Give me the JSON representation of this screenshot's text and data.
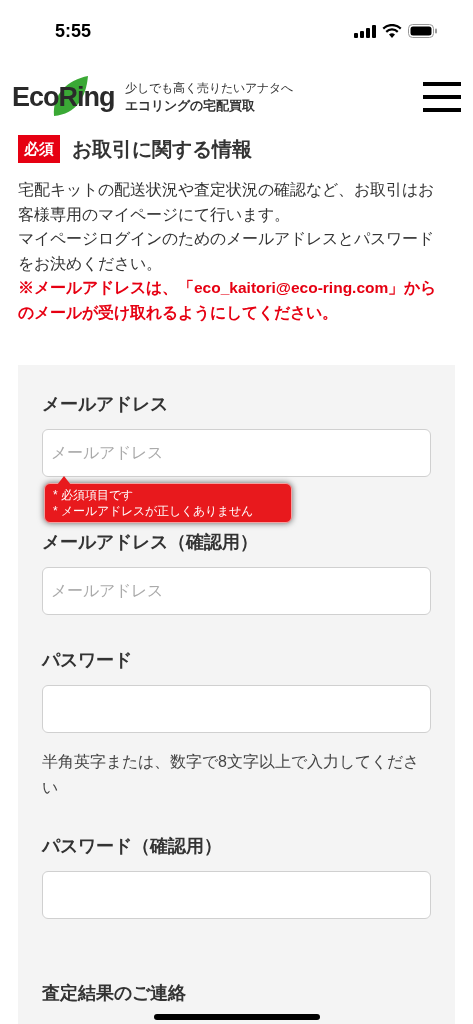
{
  "status_bar": {
    "time": "5:55"
  },
  "header": {
    "logo": "EcoRing",
    "tagline": "少しでも高く売りたいアナタへ",
    "subtitle": "エコリングの宅配買取"
  },
  "section": {
    "badge": "必須",
    "title": "お取引に関する情報"
  },
  "intro": [
    "宅配キットの配送状況や査定状況の確認など、お取引はお客様専用のマイページにて行います。",
    "マイページログインのためのメールアドレスとパスワードをお決めください。"
  ],
  "notice": "※メールアドレスは、「eco_kaitori@eco-ring.com」からのメールが受け取れるようにしてください。",
  "fields": [
    {
      "label": "メールアドレス",
      "placeholder": "メールアドレス",
      "errors": [
        "* 必須項目です",
        "* メールアドレスが正しくありません"
      ]
    },
    {
      "label": "メールアドレス（確認用）",
      "placeholder": "メールアドレス"
    },
    {
      "label": "パスワード",
      "help": "半角英字または、数字で8文字以上で入力してください"
    },
    {
      "label": "パスワード（確認用）"
    }
  ],
  "next_section": "査定結果のご連絡"
}
